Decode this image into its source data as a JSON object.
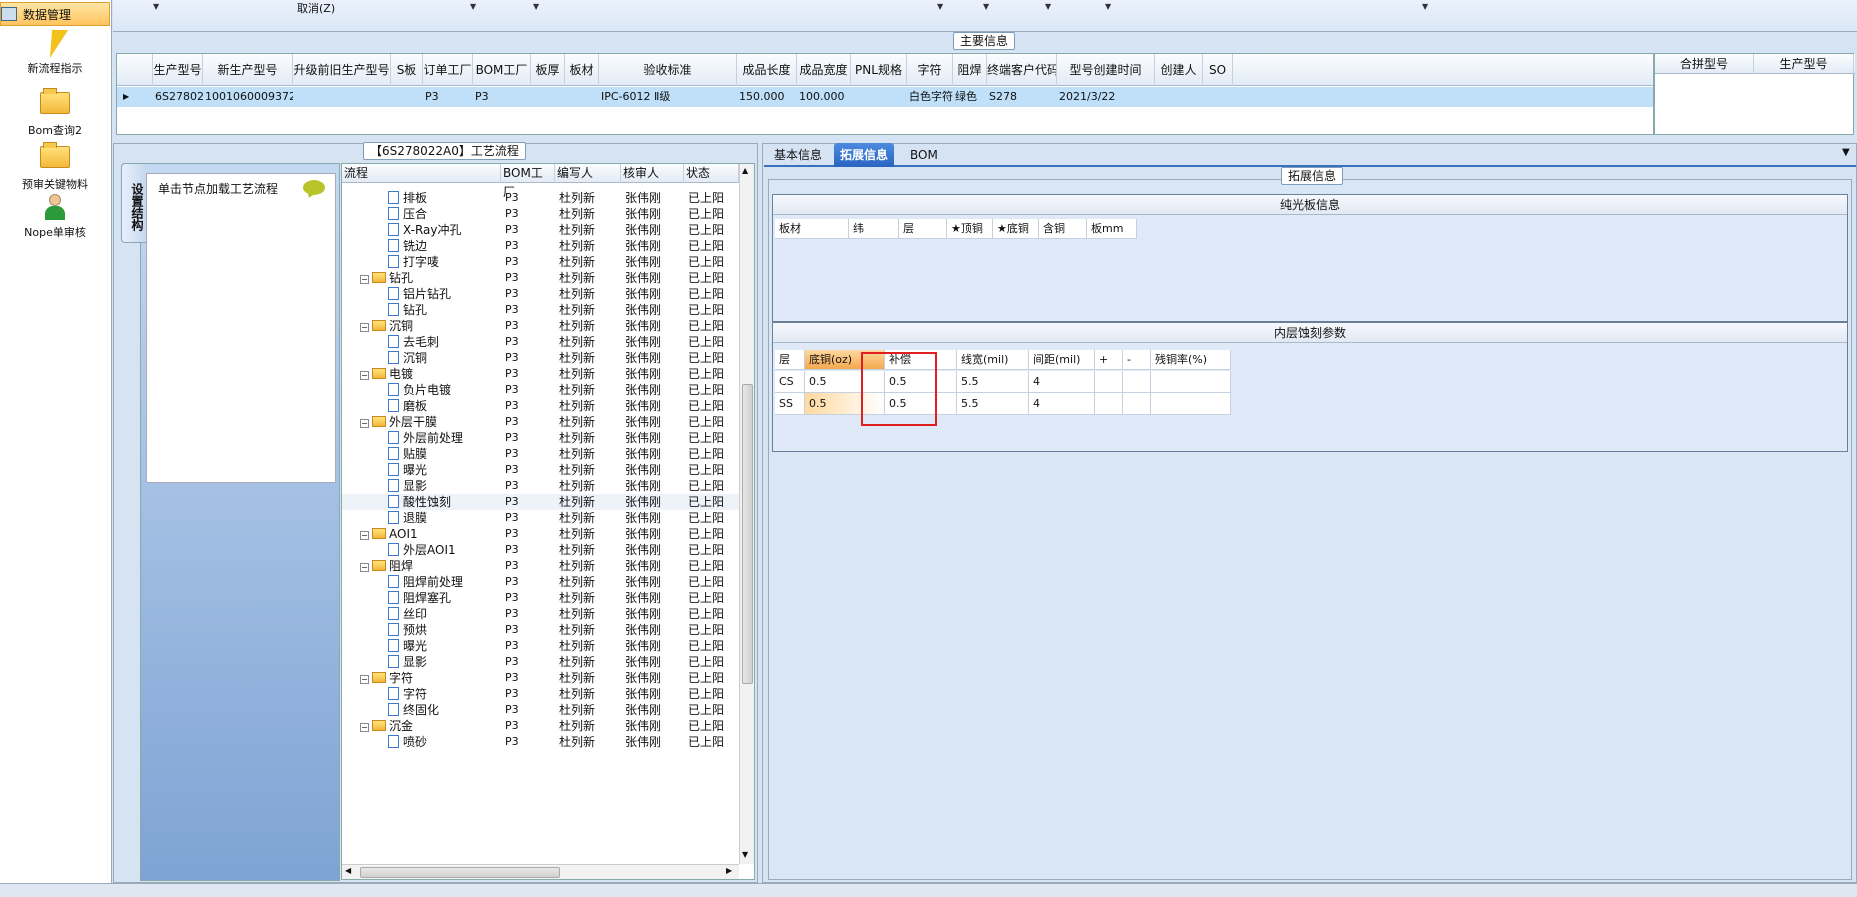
{
  "nav": {
    "header": "数据管理",
    "items": [
      {
        "label": "新流程指示",
        "icon": "lightning-icon"
      },
      {
        "label": "Bom查询2",
        "icon": "folder-icon"
      },
      {
        "label": "预审关键物料",
        "icon": "folder-icon"
      },
      {
        "label": "Nope单审核",
        "icon": "user-icon"
      }
    ]
  },
  "topbar": {
    "cancel": "取消(Z)"
  },
  "main": {
    "title": "主要信息",
    "columns": [
      "生产型号",
      "新生产型号",
      "升级前旧生产型号",
      "S板",
      "订单工厂",
      "BOM工厂",
      "板厚",
      "板材",
      "验收标准",
      "成品长度",
      "成品宽度",
      "PNL规格",
      "字符",
      "阻焊",
      "终端客户代码",
      "型号创建时间",
      "创建人",
      "SO"
    ],
    "row": [
      "6S278022A0",
      "10010600093720",
      "",
      "",
      "P3",
      "P3",
      "",
      "",
      "IPC-6012 Ⅱ级",
      "150.000",
      "100.000",
      "",
      "白色字符",
      "绿色",
      "S278",
      "2021/3/22",
      "",
      ""
    ],
    "side_columns": [
      "合拼型号",
      "生产型号"
    ]
  },
  "process": {
    "title": "【6S278022A0】工艺流程",
    "vtab": "设置结构",
    "hint": "单击节点加载工艺流程",
    "columns": [
      "流程",
      "BOM工厂",
      "编写人",
      "核审人",
      "状态"
    ],
    "rows": [
      {
        "name": "排板",
        "type": "leaf",
        "bom": "P3",
        "writer": "杜列新",
        "reviewer": "张伟刚",
        "status": "已上阳"
      },
      {
        "name": "压合",
        "type": "leaf",
        "bom": "P3",
        "writer": "杜列新",
        "reviewer": "张伟刚",
        "status": "已上阳"
      },
      {
        "name": "X-Ray冲孔",
        "type": "leaf",
        "bom": "P3",
        "writer": "杜列新",
        "reviewer": "张伟刚",
        "status": "已上阳"
      },
      {
        "name": "铣边",
        "type": "leaf",
        "bom": "P3",
        "writer": "杜列新",
        "reviewer": "张伟刚",
        "status": "已上阳"
      },
      {
        "name": "打字唛",
        "type": "leaf",
        "bom": "P3",
        "writer": "杜列新",
        "reviewer": "张伟刚",
        "status": "已上阳"
      },
      {
        "name": "钻孔",
        "type": "folder",
        "bom": "P3",
        "writer": "杜列新",
        "reviewer": "张伟刚",
        "status": "已上阳"
      },
      {
        "name": "铝片钻孔",
        "type": "leaf",
        "bom": "P3",
        "writer": "杜列新",
        "reviewer": "张伟刚",
        "status": "已上阳"
      },
      {
        "name": "钻孔",
        "type": "leaf",
        "bom": "P3",
        "writer": "杜列新",
        "reviewer": "张伟刚",
        "status": "已上阳"
      },
      {
        "name": "沉铜",
        "type": "folder",
        "bom": "P3",
        "writer": "杜列新",
        "reviewer": "张伟刚",
        "status": "已上阳"
      },
      {
        "name": "去毛刺",
        "type": "leaf",
        "bom": "P3",
        "writer": "杜列新",
        "reviewer": "张伟刚",
        "status": "已上阳"
      },
      {
        "name": "沉铜",
        "type": "leaf",
        "bom": "P3",
        "writer": "杜列新",
        "reviewer": "张伟刚",
        "status": "已上阳"
      },
      {
        "name": "电镀",
        "type": "folder",
        "bom": "P3",
        "writer": "杜列新",
        "reviewer": "张伟刚",
        "status": "已上阳"
      },
      {
        "name": "负片电镀",
        "type": "leaf",
        "bom": "P3",
        "writer": "杜列新",
        "reviewer": "张伟刚",
        "status": "已上阳"
      },
      {
        "name": "磨板",
        "type": "leaf",
        "bom": "P3",
        "writer": "杜列新",
        "reviewer": "张伟刚",
        "status": "已上阳"
      },
      {
        "name": "外层干膜",
        "type": "folder",
        "bom": "P3",
        "writer": "杜列新",
        "reviewer": "张伟刚",
        "status": "已上阳"
      },
      {
        "name": "外层前处理",
        "type": "leaf",
        "bom": "P3",
        "writer": "杜列新",
        "reviewer": "张伟刚",
        "status": "已上阳"
      },
      {
        "name": "贴膜",
        "type": "leaf",
        "bom": "P3",
        "writer": "杜列新",
        "reviewer": "张伟刚",
        "status": "已上阳"
      },
      {
        "name": "曝光",
        "type": "leaf",
        "bom": "P3",
        "writer": "杜列新",
        "reviewer": "张伟刚",
        "status": "已上阳"
      },
      {
        "name": "显影",
        "type": "leaf",
        "bom": "P3",
        "writer": "杜列新",
        "reviewer": "张伟刚",
        "status": "已上阳"
      },
      {
        "name": "酸性蚀刻",
        "type": "leaf",
        "bom": "P3",
        "writer": "杜列新",
        "reviewer": "张伟刚",
        "status": "已上阳",
        "selected": true
      },
      {
        "name": "退膜",
        "type": "leaf",
        "bom": "P3",
        "writer": "杜列新",
        "reviewer": "张伟刚",
        "status": "已上阳"
      },
      {
        "name": "AOI1",
        "type": "folder",
        "bom": "P3",
        "writer": "杜列新",
        "reviewer": "张伟刚",
        "status": "已上阳"
      },
      {
        "name": "外层AOI1",
        "type": "leaf",
        "bom": "P3",
        "writer": "杜列新",
        "reviewer": "张伟刚",
        "status": "已上阳"
      },
      {
        "name": "阻焊",
        "type": "folder",
        "bom": "P3",
        "writer": "杜列新",
        "reviewer": "张伟刚",
        "status": "已上阳"
      },
      {
        "name": "阻焊前处理",
        "type": "leaf",
        "bom": "P3",
        "writer": "杜列新",
        "reviewer": "张伟刚",
        "status": "已上阳"
      },
      {
        "name": "阻焊塞孔",
        "type": "leaf",
        "bom": "P3",
        "writer": "杜列新",
        "reviewer": "张伟刚",
        "status": "已上阳"
      },
      {
        "name": "丝印",
        "type": "leaf",
        "bom": "P3",
        "writer": "杜列新",
        "reviewer": "张伟刚",
        "status": "已上阳"
      },
      {
        "name": "预烘",
        "type": "leaf",
        "bom": "P3",
        "writer": "杜列新",
        "reviewer": "张伟刚",
        "status": "已上阳"
      },
      {
        "name": "曝光",
        "type": "leaf",
        "bom": "P3",
        "writer": "杜列新",
        "reviewer": "张伟刚",
        "status": "已上阳"
      },
      {
        "name": "显影",
        "type": "leaf",
        "bom": "P3",
        "writer": "杜列新",
        "reviewer": "张伟刚",
        "status": "已上阳"
      },
      {
        "name": "字符",
        "type": "folder",
        "bom": "P3",
        "writer": "杜列新",
        "reviewer": "张伟刚",
        "status": "已上阳"
      },
      {
        "name": "字符",
        "type": "leaf",
        "bom": "P3",
        "writer": "杜列新",
        "reviewer": "张伟刚",
        "status": "已上阳"
      },
      {
        "name": "终固化",
        "type": "leaf",
        "bom": "P3",
        "writer": "杜列新",
        "reviewer": "张伟刚",
        "status": "已上阳"
      },
      {
        "name": "沉金",
        "type": "folder",
        "bom": "P3",
        "writer": "杜列新",
        "reviewer": "张伟刚",
        "status": "已上阳"
      },
      {
        "name": "喷砂",
        "type": "leaf",
        "bom": "P3",
        "writer": "杜列新",
        "reviewer": "张伟刚",
        "status": "已上阳"
      }
    ]
  },
  "tabs": [
    {
      "label": "基本信息"
    },
    {
      "label": "拓展信息",
      "active": true
    },
    {
      "label": "BOM"
    }
  ],
  "ext": {
    "title": "拓展信息",
    "bare": {
      "title": "纯光板信息",
      "columns": [
        "板材",
        "纬",
        "层",
        "★顶铜",
        "★底铜",
        "含铜",
        "板mm"
      ]
    },
    "inner": {
      "title": "内层蚀刻参数",
      "columns": [
        "层",
        "底铜(oz)",
        "补偿",
        "线宽(mil)",
        "间距(mil)",
        "+",
        "-",
        "残铜率(%)"
      ],
      "rows": [
        [
          "CS",
          "0.5",
          "0.5",
          "5.5",
          "4",
          "",
          "",
          ""
        ],
        [
          "SS",
          "0.5",
          "0.5",
          "5.5",
          "4",
          "",
          "",
          ""
        ]
      ]
    }
  }
}
